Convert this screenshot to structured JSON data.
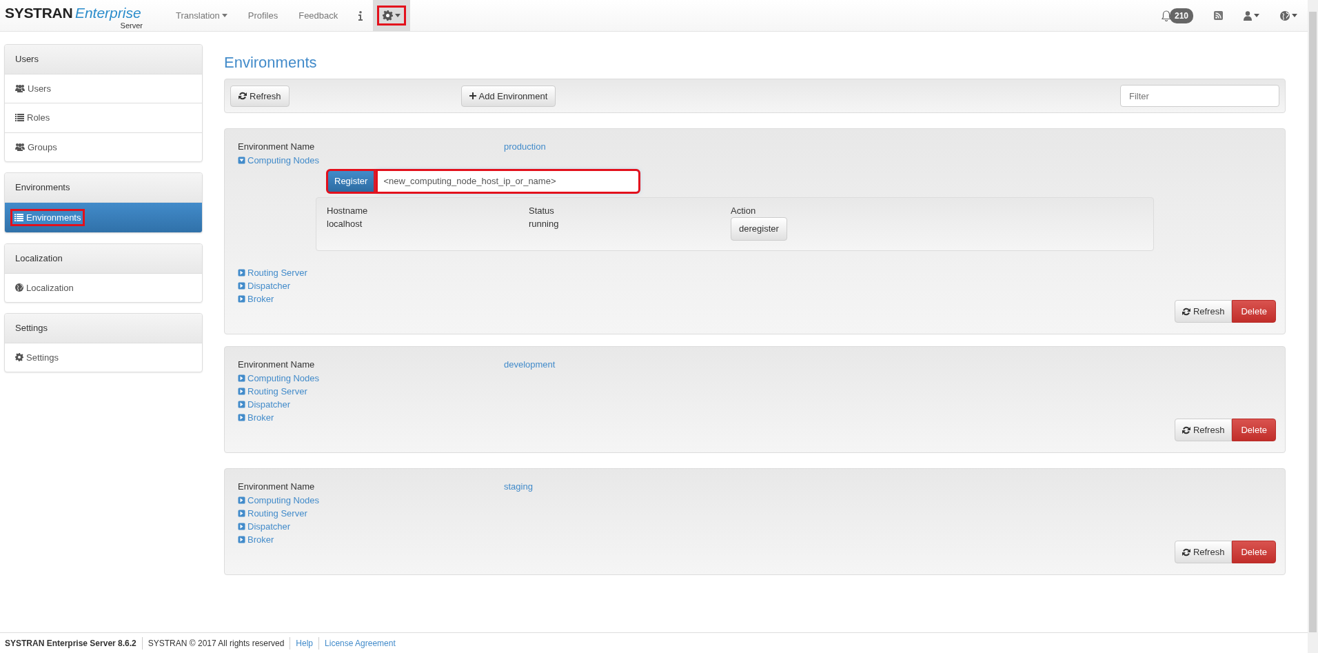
{
  "navbar": {
    "brand": "SYSTRAN",
    "brand_italic": "Enterprise",
    "brand_sub": "Server",
    "items": [
      {
        "kind": "dropdown",
        "label": "Translation",
        "selected": false,
        "highlighted": false
      },
      {
        "kind": "link",
        "label": "Profiles",
        "selected": false,
        "highlighted": false
      },
      {
        "kind": "link",
        "label": "Feedback",
        "selected": false,
        "highlighted": false
      },
      {
        "kind": "info",
        "selected": false,
        "highlighted": false
      },
      {
        "kind": "gear",
        "selected": true,
        "highlighted": true
      }
    ],
    "notifications": "210"
  },
  "sidebar": {
    "groups": [
      {
        "title": "Users",
        "items": [
          {
            "kind": "people",
            "label": "Users",
            "selected": false,
            "highlighted": false
          },
          {
            "kind": "list",
            "label": "Roles",
            "selected": false,
            "highlighted": false
          },
          {
            "kind": "people",
            "label": "Groups",
            "selected": false,
            "highlighted": false
          }
        ]
      },
      {
        "title": "Environments",
        "items": [
          {
            "kind": "list",
            "label": "Environments",
            "selected": true,
            "highlighted": true
          }
        ]
      },
      {
        "title": "Localization",
        "items": [
          {
            "kind": "globe",
            "label": "Localization",
            "selected": false,
            "highlighted": false
          }
        ]
      },
      {
        "title": "Settings",
        "items": [
          {
            "kind": "gear",
            "label": "Settings",
            "selected": false,
            "highlighted": false
          }
        ]
      }
    ]
  },
  "page_title": "Environments",
  "toolbar": {
    "refresh": "Refresh",
    "add": "Add Environment",
    "filter_placeholder": "Filter"
  },
  "environments": [
    {
      "label": "Environment Name",
      "name": "production",
      "sections": [
        {
          "label": "Computing Nodes",
          "expanded": true,
          "register_button": "Register",
          "register_highlighted": true,
          "host_value": "<new_computing_node_host_ip_or_name>",
          "host_highlighted": true,
          "table": {
            "columns": [
              "Hostname",
              "Status",
              "Action"
            ],
            "rows": [
              {
                "hostname": "localhost",
                "status": "running",
                "action": "deregister"
              }
            ]
          }
        },
        {
          "label": "Routing Server",
          "expanded": false
        },
        {
          "label": "Dispatcher",
          "expanded": false
        },
        {
          "label": "Broker",
          "expanded": false
        }
      ],
      "refresh": "Refresh",
      "delete": "Delete"
    },
    {
      "label": "Environment Name",
      "name": "development",
      "sections": [
        {
          "label": "Computing Nodes",
          "expanded": false
        },
        {
          "label": "Routing Server",
          "expanded": false
        },
        {
          "label": "Dispatcher",
          "expanded": false
        },
        {
          "label": "Broker",
          "expanded": false
        }
      ],
      "refresh": "Refresh",
      "delete": "Delete"
    },
    {
      "label": "Environment Name",
      "name": "staging",
      "sections": [
        {
          "label": "Computing Nodes",
          "expanded": false
        },
        {
          "label": "Routing Server",
          "expanded": false
        },
        {
          "label": "Dispatcher",
          "expanded": false
        },
        {
          "label": "Broker",
          "expanded": false
        }
      ],
      "refresh": "Refresh",
      "delete": "Delete"
    }
  ],
  "footer": {
    "version": "SYSTRAN Enterprise Server 8.6.2",
    "copyright": "SYSTRAN © 2017 All rights reserved",
    "links": [
      "Help",
      "License Agreement"
    ]
  }
}
